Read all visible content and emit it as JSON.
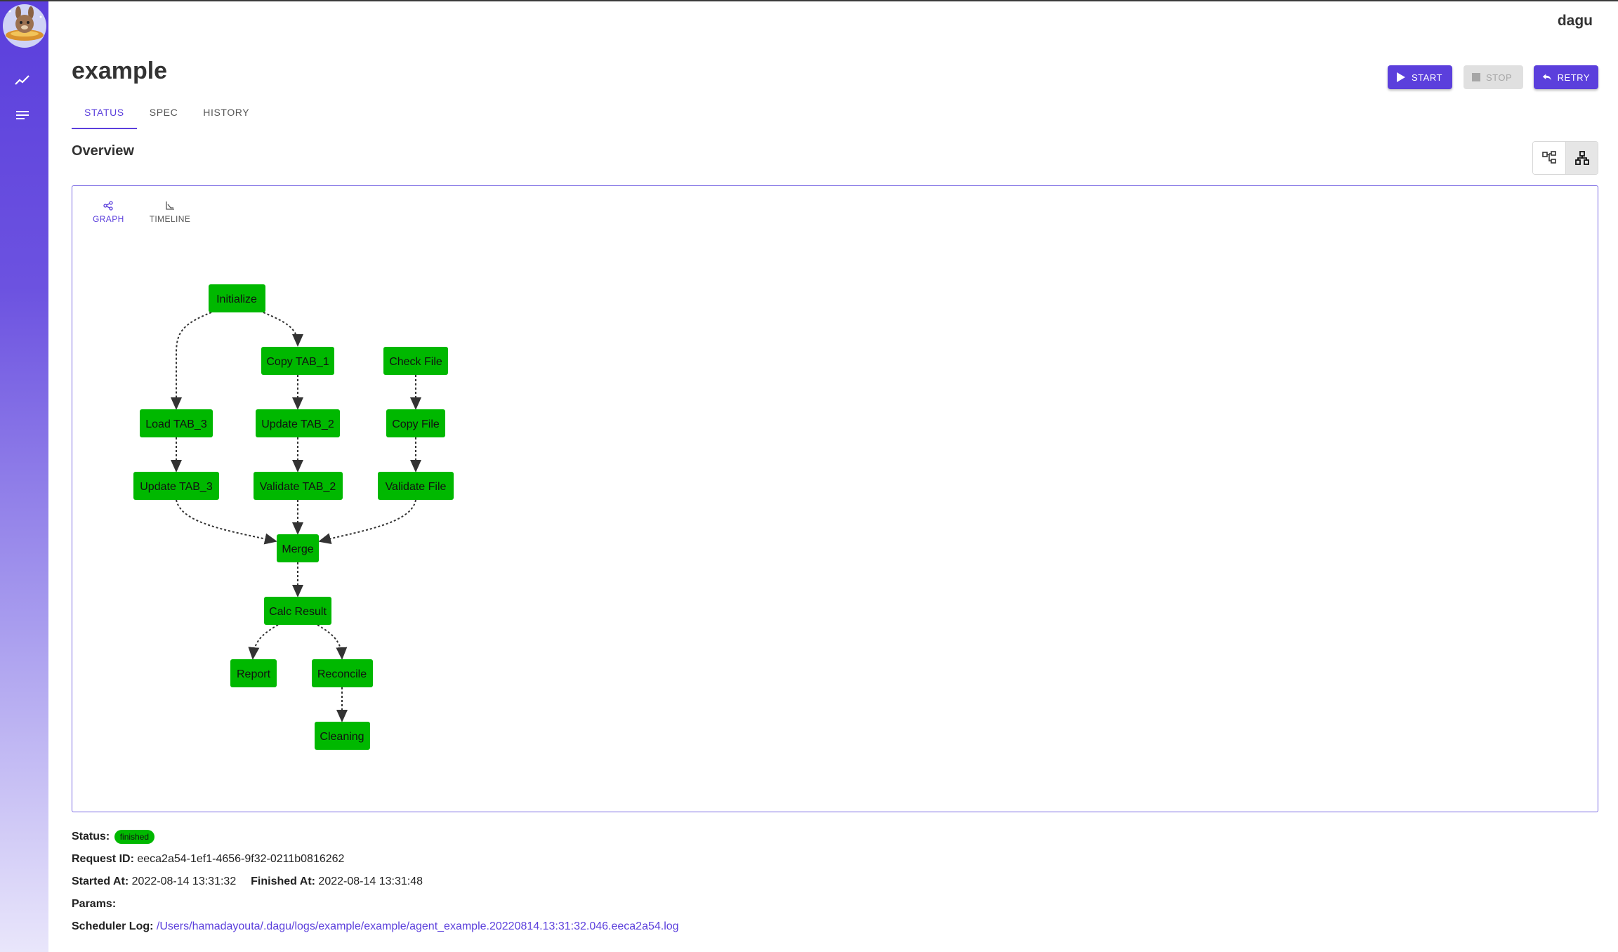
{
  "app": {
    "name": "dagu"
  },
  "sidebar": {
    "items": [
      {
        "icon": "chart-icon"
      },
      {
        "icon": "list-icon"
      }
    ]
  },
  "page": {
    "title": "example"
  },
  "tabs": [
    {
      "label": "STATUS",
      "active": true
    },
    {
      "label": "SPEC",
      "active": false
    },
    {
      "label": "HISTORY",
      "active": false
    }
  ],
  "actions": {
    "start_label": "START",
    "stop_label": "STOP",
    "retry_label": "RETRY"
  },
  "overview": {
    "title": "Overview"
  },
  "view_tabs": {
    "graph_label": "GRAPH",
    "timeline_label": "TIMELINE"
  },
  "graph": {
    "nodes": [
      {
        "id": "init",
        "label": "Initialize"
      },
      {
        "id": "copytab1",
        "label": "Copy TAB_1"
      },
      {
        "id": "checkfile",
        "label": "Check File"
      },
      {
        "id": "loadtab3",
        "label": "Load TAB_3"
      },
      {
        "id": "updatetab2",
        "label": "Update TAB_2"
      },
      {
        "id": "copyfile",
        "label": "Copy File"
      },
      {
        "id": "updatetab3",
        "label": "Update TAB_3"
      },
      {
        "id": "validatetab2",
        "label": "Validate TAB_2"
      },
      {
        "id": "validatefile",
        "label": "Validate File"
      },
      {
        "id": "merge",
        "label": "Merge"
      },
      {
        "id": "calc",
        "label": "Calc Result"
      },
      {
        "id": "report",
        "label": "Report"
      },
      {
        "id": "reconcile",
        "label": "Reconcile"
      },
      {
        "id": "cleaning",
        "label": "Cleaning"
      }
    ],
    "edges": [
      [
        "init",
        "loadtab3"
      ],
      [
        "init",
        "copytab1"
      ],
      [
        "checkfile",
        "copyfile"
      ],
      [
        "copytab1",
        "updatetab2"
      ],
      [
        "loadtab3",
        "updatetab3"
      ],
      [
        "updatetab2",
        "validatetab2"
      ],
      [
        "copyfile",
        "validatefile"
      ],
      [
        "updatetab3",
        "merge"
      ],
      [
        "validatetab2",
        "merge"
      ],
      [
        "validatefile",
        "merge"
      ],
      [
        "merge",
        "calc"
      ],
      [
        "calc",
        "report"
      ],
      [
        "calc",
        "reconcile"
      ],
      [
        "reconcile",
        "cleaning"
      ]
    ],
    "node_color": "#00b800"
  },
  "status": {
    "status_label": "Status:",
    "status_value": "finished",
    "request_id_label": "Request ID:",
    "request_id": "eeca2a54-1ef1-4656-9f32-0211b0816262",
    "started_label": "Started At:",
    "started_at": "2022-08-14 13:31:32",
    "finished_label": "Finished At:",
    "finished_at": "2022-08-14 13:31:48",
    "params_label": "Params:",
    "params": "",
    "log_label": "Scheduler Log:",
    "log_path": "/Users/hamadayouta/.dagu/logs/example/example/agent_example.20220814.13:31:32.046.eeca2a54.log"
  },
  "colors": {
    "accent": "#5b3fdc",
    "success": "#00b800"
  }
}
